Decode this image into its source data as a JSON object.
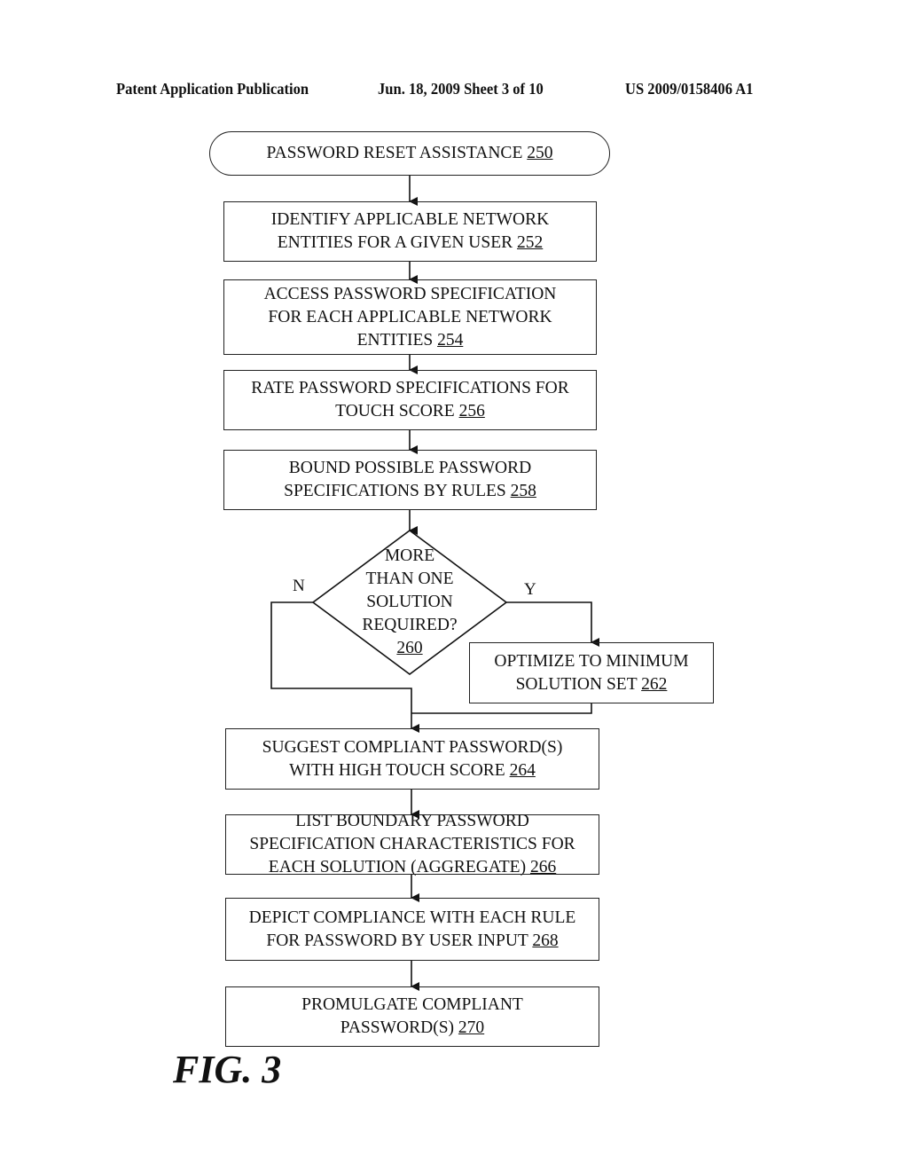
{
  "header": {
    "publication": "Patent Application Publication",
    "date_sheet": "Jun. 18, 2009  Sheet 3 of 10",
    "number": "US 2009/0158406 A1"
  },
  "flowchart": {
    "start": {
      "text": "PASSWORD RESET ASSISTANCE",
      "ref": "250"
    },
    "steps": [
      {
        "id": "252",
        "lines": [
          "IDENTIFY APPLICABLE NETWORK",
          "ENTITIES FOR A GIVEN USER"
        ],
        "ref": "252"
      },
      {
        "id": "254",
        "lines": [
          "ACCESS PASSWORD SPECIFICATION",
          "FOR EACH APPLICABLE NETWORK",
          "ENTITIES"
        ],
        "ref": "254"
      },
      {
        "id": "256",
        "lines": [
          "RATE PASSWORD SPECIFICATIONS FOR",
          "TOUCH SCORE"
        ],
        "ref": "256"
      },
      {
        "id": "258",
        "lines": [
          "BOUND POSSIBLE PASSWORD",
          "SPECIFICATIONS BY RULES"
        ],
        "ref": "258"
      }
    ],
    "decision": {
      "lines": [
        "MORE",
        "THAN ONE",
        "SOLUTION",
        "REQUIRED?"
      ],
      "ref": "260",
      "no_label": "N",
      "yes_label": "Y"
    },
    "yes_branch": {
      "lines": [
        "OPTIMIZE TO MINIMUM",
        "SOLUTION SET"
      ],
      "ref": "262"
    },
    "after": [
      {
        "id": "264",
        "lines": [
          "SUGGEST COMPLIANT PASSWORD(S)",
          "WITH HIGH TOUCH SCORE"
        ],
        "ref": "264"
      },
      {
        "id": "266",
        "lines": [
          "LIST BOUNDARY PASSWORD",
          "SPECIFICATION CHARACTERISTICS FOR",
          "EACH SOLUTION (AGGREGATE)"
        ],
        "ref": "266"
      },
      {
        "id": "268",
        "lines": [
          "DEPICT COMPLIANCE WITH EACH RULE",
          "FOR PASSWORD BY USER INPUT"
        ],
        "ref": "268"
      },
      {
        "id": "270",
        "lines": [
          "PROMULGATE COMPLIANT",
          "PASSWORD(S)"
        ],
        "ref": "270"
      }
    ]
  },
  "figure_label": "FIG. 3"
}
